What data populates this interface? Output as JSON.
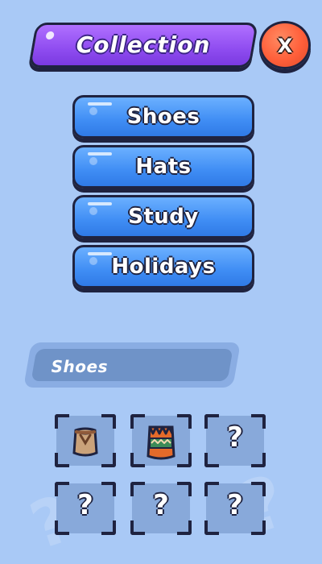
{
  "header": {
    "title": "Collection",
    "close_label": "X"
  },
  "categories": [
    {
      "label": "Shoes"
    },
    {
      "label": "Hats"
    },
    {
      "label": "Study"
    },
    {
      "label": "Holidays"
    }
  ],
  "selected_category": {
    "label": "Shoes"
  },
  "slots": [
    {
      "state": "unlocked",
      "icon": "brown-bag-icon",
      "text": ""
    },
    {
      "state": "unlocked",
      "icon": "zigzag-boot-icon",
      "text": ""
    },
    {
      "state": "locked",
      "icon": "question-mark-icon",
      "text": "?"
    },
    {
      "state": "locked",
      "icon": "question-mark-icon",
      "text": "?"
    },
    {
      "state": "locked",
      "icon": "question-mark-icon",
      "text": "?"
    },
    {
      "state": "locked",
      "icon": "question-mark-icon",
      "text": "?"
    }
  ],
  "colors": {
    "background": "#a9c9f6",
    "title_purple": "#8f4cf0",
    "close_orange": "#ff5f3a",
    "button_blue": "#3f8df4",
    "outline": "#1f2340",
    "slot_bg": "#88a9da"
  }
}
